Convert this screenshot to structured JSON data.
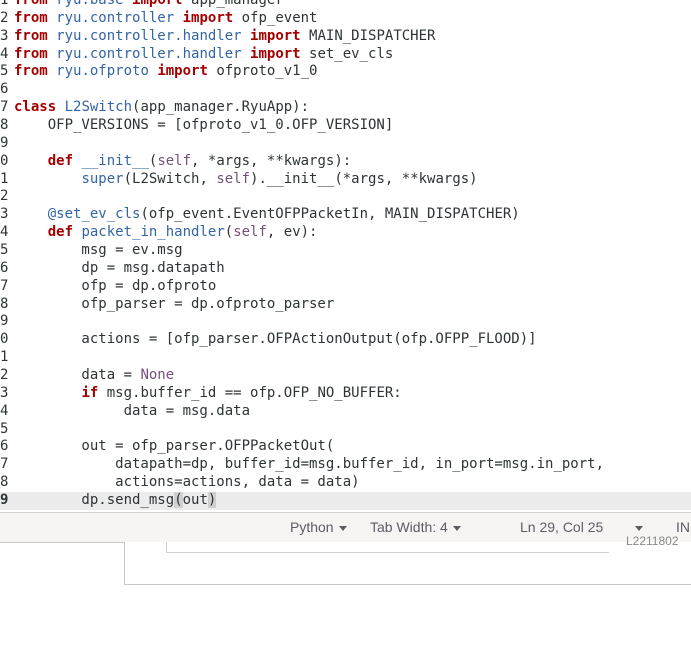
{
  "editor": {
    "lines": [
      {
        "n": "1",
        "tokens": [
          [
            "kw",
            "from"
          ],
          [
            "",
            "' '"
          ],
          [
            "mod",
            "ryu.base"
          ],
          [
            "",
            "' '"
          ],
          [
            "kw",
            "import"
          ],
          [
            "",
            "' app_manager'"
          ]
        ]
      },
      {
        "n": "2",
        "tokens": [
          [
            "kw",
            "from"
          ],
          [
            "",
            "' '"
          ],
          [
            "mod",
            "ryu.controller"
          ],
          [
            "",
            "' '"
          ],
          [
            "kw",
            "import"
          ],
          [
            "",
            "' ofp_event'"
          ]
        ]
      },
      {
        "n": "3",
        "tokens": [
          [
            "kw",
            "from"
          ],
          [
            "",
            "' '"
          ],
          [
            "mod",
            "ryu.controller.handler"
          ],
          [
            "",
            "' '"
          ],
          [
            "kw",
            "import"
          ],
          [
            "",
            "' MAIN_DISPATCHER'"
          ]
        ]
      },
      {
        "n": "4",
        "tokens": [
          [
            "kw",
            "from"
          ],
          [
            "",
            "' '"
          ],
          [
            "mod",
            "ryu.controller.handler"
          ],
          [
            "",
            "' '"
          ],
          [
            "kw",
            "import"
          ],
          [
            "",
            "' set_ev_cls'"
          ]
        ]
      },
      {
        "n": "5",
        "tokens": [
          [
            "kw",
            "from"
          ],
          [
            "",
            "' '"
          ],
          [
            "mod",
            "ryu.ofproto"
          ],
          [
            "",
            "' '"
          ],
          [
            "kw",
            "import"
          ],
          [
            "",
            "' ofproto_v1_0'"
          ]
        ]
      },
      {
        "n": "6",
        "tokens": []
      },
      {
        "n": "7",
        "tokens": [
          [
            "kw",
            "class"
          ],
          [
            "",
            "' '"
          ],
          [
            "cls",
            "L2Switch"
          ],
          [
            "",
            "'(app_manager.RyuApp):'"
          ]
        ]
      },
      {
        "n": "8",
        "tokens": [
          [
            "",
            "'    OFP_VERSIONS = [ofproto_v1_0.OFP_VERSION]'"
          ]
        ]
      },
      {
        "n": "9",
        "tokens": []
      },
      {
        "n": "0",
        "tokens": [
          [
            "",
            "'    '"
          ],
          [
            "kw",
            "def"
          ],
          [
            "",
            "' '"
          ],
          [
            "cls",
            "__init__"
          ],
          [
            "",
            "'('"
          ],
          [
            "self",
            "self"
          ],
          [
            "",
            "', *args, **kwargs):'"
          ]
        ]
      },
      {
        "n": "1",
        "tokens": [
          [
            "",
            "'        '"
          ],
          [
            "cls",
            "super"
          ],
          [
            "",
            "'(L2Switch, '"
          ],
          [
            "self",
            "self"
          ],
          [
            "",
            "').__init__(*args, **kwargs)'"
          ]
        ]
      },
      {
        "n": "2",
        "tokens": []
      },
      {
        "n": "3",
        "tokens": [
          [
            "",
            "'    '"
          ],
          [
            "cls",
            "@set_ev_cls"
          ],
          [
            "",
            "'(ofp_event.EventOFPPacketIn, MAIN_DISPATCHER)'"
          ]
        ]
      },
      {
        "n": "4",
        "tokens": [
          [
            "",
            "'    '"
          ],
          [
            "kw",
            "def"
          ],
          [
            "",
            "' '"
          ],
          [
            "cls",
            "packet_in_handler"
          ],
          [
            "",
            "'('"
          ],
          [
            "self",
            "self"
          ],
          [
            "",
            "', ev):'"
          ]
        ]
      },
      {
        "n": "5",
        "tokens": [
          [
            "",
            "'        msg = ev.msg'"
          ]
        ]
      },
      {
        "n": "6",
        "tokens": [
          [
            "",
            "'        dp = msg.datapath'"
          ]
        ]
      },
      {
        "n": "7",
        "tokens": [
          [
            "",
            "'        ofp = dp.ofproto'"
          ]
        ]
      },
      {
        "n": "8",
        "tokens": [
          [
            "",
            "'        ofp_parser = dp.ofproto_parser'"
          ]
        ]
      },
      {
        "n": "9",
        "tokens": []
      },
      {
        "n": "0",
        "tokens": [
          [
            "",
            "'        actions = [ofp_parser.OFPActionOutput(ofp.OFPP_FLOOD)]'"
          ]
        ]
      },
      {
        "n": "1",
        "tokens": []
      },
      {
        "n": "2",
        "tokens": [
          [
            "",
            "'        data = '"
          ],
          [
            "const",
            "None"
          ]
        ]
      },
      {
        "n": "3",
        "tokens": [
          [
            "",
            "'        '"
          ],
          [
            "kw",
            "if"
          ],
          [
            "",
            "' msg.buffer_id == ofp.OFP_NO_BUFFER:'"
          ]
        ]
      },
      {
        "n": "4",
        "tokens": [
          [
            "",
            "'             data = msg.data'"
          ]
        ]
      },
      {
        "n": "5",
        "tokens": []
      },
      {
        "n": "6",
        "tokens": [
          [
            "",
            "'        out = ofp_parser.OFPPacketOut('"
          ]
        ]
      },
      {
        "n": "7",
        "tokens": [
          [
            "",
            "'            datapath=dp, buffer_id=msg.buffer_id, in_port=msg.in_port,'"
          ]
        ]
      },
      {
        "n": "8",
        "tokens": [
          [
            "",
            "'            actions=actions, data = data)'"
          ]
        ]
      },
      {
        "n": "9",
        "current": true,
        "tokens": [
          [
            "",
            "'        dp.send_msg'"
          ],
          [
            "bracket",
            "("
          ],
          [
            "",
            "'out'"
          ],
          [
            "bracket",
            ")"
          ]
        ]
      }
    ]
  },
  "statusbar": {
    "language": "Python",
    "tab_width": "Tab Width: 4",
    "position": "Ln 29, Col 25",
    "mode": "IN"
  },
  "background": {
    "partial_text": "L2211802"
  }
}
